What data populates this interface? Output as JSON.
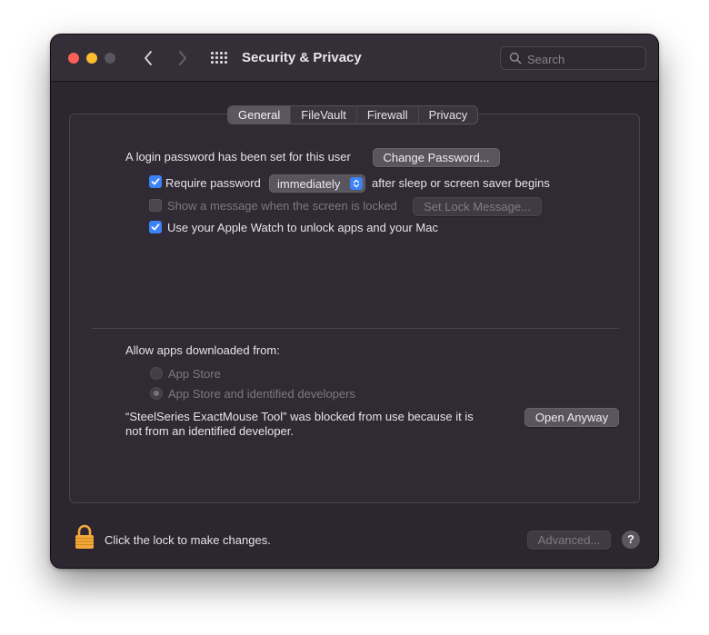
{
  "window": {
    "title": "Security & Privacy",
    "search_placeholder": "Search"
  },
  "tabs": [
    {
      "label": "General",
      "active": true
    },
    {
      "label": "FileVault",
      "active": false
    },
    {
      "label": "Firewall",
      "active": false
    },
    {
      "label": "Privacy",
      "active": false
    }
  ],
  "general": {
    "login_text": "A login password has been set for this user",
    "change_password_label": "Change Password...",
    "require_password": {
      "checked": true,
      "label": "Require password",
      "delay_value": "immediately",
      "suffix": "after sleep or screen saver begins"
    },
    "show_message": {
      "checked": false,
      "enabled": false,
      "label": "Show a message when the screen is locked",
      "button_label": "Set Lock Message..."
    },
    "apple_watch": {
      "checked": true,
      "label": "Use your Apple Watch to unlock apps and your Mac"
    }
  },
  "downloads": {
    "heading": "Allow apps downloaded from:",
    "options": [
      {
        "label": "App Store",
        "selected": false
      },
      {
        "label": "App Store and identified developers",
        "selected": true
      }
    ],
    "blocked_line1": "“SteelSeries ExactMouse Tool” was blocked from use because it is",
    "blocked_line2": "not from an identified developer.",
    "open_anyway_label": "Open Anyway"
  },
  "footer": {
    "lock_text": "Click the lock to make changes.",
    "advanced_label": "Advanced...",
    "help_label": "?"
  },
  "colors": {
    "accent": "#3b82f7",
    "lock": "#f3a93b",
    "window_bg": "#2b2630"
  }
}
